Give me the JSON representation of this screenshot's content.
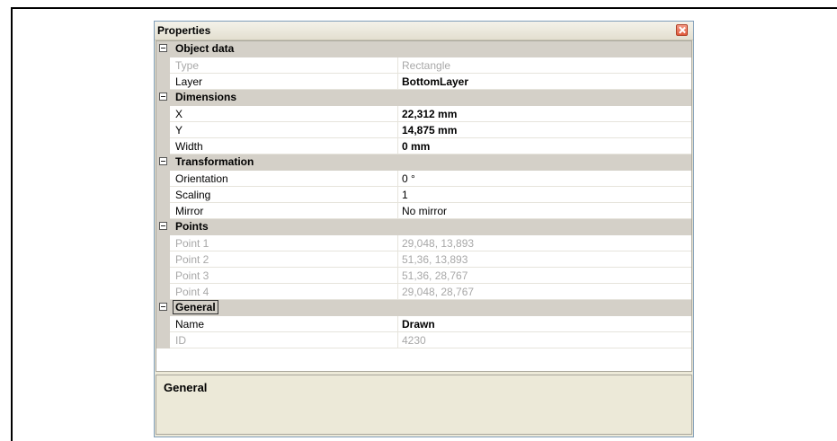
{
  "panel": {
    "title": "Properties"
  },
  "categories": [
    {
      "label": "Object data",
      "rows": [
        {
          "name": "Type",
          "value": "Rectangle",
          "disabled": true,
          "bold": false
        },
        {
          "name": "Layer",
          "value": "BottomLayer",
          "disabled": false,
          "bold": true
        }
      ]
    },
    {
      "label": "Dimensions",
      "rows": [
        {
          "name": "X",
          "value": "22,312 mm",
          "disabled": false,
          "bold": true
        },
        {
          "name": "Y",
          "value": "14,875 mm",
          "disabled": false,
          "bold": true
        },
        {
          "name": "Width",
          "value": "0 mm",
          "disabled": false,
          "bold": true
        }
      ]
    },
    {
      "label": "Transformation",
      "rows": [
        {
          "name": "Orientation",
          "value": "0 °",
          "disabled": false,
          "bold": false
        },
        {
          "name": "Scaling",
          "value": "1",
          "disabled": false,
          "bold": false
        },
        {
          "name": "Mirror",
          "value": "No mirror",
          "disabled": false,
          "bold": false
        }
      ]
    },
    {
      "label": "Points",
      "rows": [
        {
          "name": "Point 1",
          "value": "29,048, 13,893",
          "disabled": true,
          "bold": false
        },
        {
          "name": "Point 2",
          "value": "51,36, 13,893",
          "disabled": true,
          "bold": false
        },
        {
          "name": "Point 3",
          "value": "51,36, 28,767",
          "disabled": true,
          "bold": false
        },
        {
          "name": "Point 4",
          "value": "29,048, 28,767",
          "disabled": true,
          "bold": false
        }
      ]
    },
    {
      "label": "General",
      "selected": true,
      "rows": [
        {
          "name": "Name",
          "value": "Drawn",
          "disabled": false,
          "bold": true
        },
        {
          "name": "ID",
          "value": "4230",
          "disabled": true,
          "bold": false
        }
      ]
    }
  ],
  "description": {
    "title": "General"
  },
  "icons": {
    "close": "close-icon",
    "expander": "collapse-minus-icon"
  }
}
